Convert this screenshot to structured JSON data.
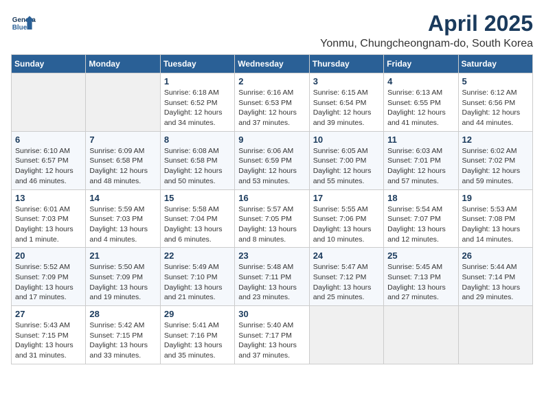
{
  "logo": {
    "line1": "General",
    "line2": "Blue"
  },
  "title": "April 2025",
  "subtitle": "Yonmu, Chungcheongnam-do, South Korea",
  "days_of_week": [
    "Sunday",
    "Monday",
    "Tuesday",
    "Wednesday",
    "Thursday",
    "Friday",
    "Saturday"
  ],
  "weeks": [
    [
      {
        "day": "",
        "info": ""
      },
      {
        "day": "",
        "info": ""
      },
      {
        "day": "1",
        "info": "Sunrise: 6:18 AM\nSunset: 6:52 PM\nDaylight: 12 hours and 34 minutes."
      },
      {
        "day": "2",
        "info": "Sunrise: 6:16 AM\nSunset: 6:53 PM\nDaylight: 12 hours and 37 minutes."
      },
      {
        "day": "3",
        "info": "Sunrise: 6:15 AM\nSunset: 6:54 PM\nDaylight: 12 hours and 39 minutes."
      },
      {
        "day": "4",
        "info": "Sunrise: 6:13 AM\nSunset: 6:55 PM\nDaylight: 12 hours and 41 minutes."
      },
      {
        "day": "5",
        "info": "Sunrise: 6:12 AM\nSunset: 6:56 PM\nDaylight: 12 hours and 44 minutes."
      }
    ],
    [
      {
        "day": "6",
        "info": "Sunrise: 6:10 AM\nSunset: 6:57 PM\nDaylight: 12 hours and 46 minutes."
      },
      {
        "day": "7",
        "info": "Sunrise: 6:09 AM\nSunset: 6:58 PM\nDaylight: 12 hours and 48 minutes."
      },
      {
        "day": "8",
        "info": "Sunrise: 6:08 AM\nSunset: 6:58 PM\nDaylight: 12 hours and 50 minutes."
      },
      {
        "day": "9",
        "info": "Sunrise: 6:06 AM\nSunset: 6:59 PM\nDaylight: 12 hours and 53 minutes."
      },
      {
        "day": "10",
        "info": "Sunrise: 6:05 AM\nSunset: 7:00 PM\nDaylight: 12 hours and 55 minutes."
      },
      {
        "day": "11",
        "info": "Sunrise: 6:03 AM\nSunset: 7:01 PM\nDaylight: 12 hours and 57 minutes."
      },
      {
        "day": "12",
        "info": "Sunrise: 6:02 AM\nSunset: 7:02 PM\nDaylight: 12 hours and 59 minutes."
      }
    ],
    [
      {
        "day": "13",
        "info": "Sunrise: 6:01 AM\nSunset: 7:03 PM\nDaylight: 13 hours and 1 minute."
      },
      {
        "day": "14",
        "info": "Sunrise: 5:59 AM\nSunset: 7:03 PM\nDaylight: 13 hours and 4 minutes."
      },
      {
        "day": "15",
        "info": "Sunrise: 5:58 AM\nSunset: 7:04 PM\nDaylight: 13 hours and 6 minutes."
      },
      {
        "day": "16",
        "info": "Sunrise: 5:57 AM\nSunset: 7:05 PM\nDaylight: 13 hours and 8 minutes."
      },
      {
        "day": "17",
        "info": "Sunrise: 5:55 AM\nSunset: 7:06 PM\nDaylight: 13 hours and 10 minutes."
      },
      {
        "day": "18",
        "info": "Sunrise: 5:54 AM\nSunset: 7:07 PM\nDaylight: 13 hours and 12 minutes."
      },
      {
        "day": "19",
        "info": "Sunrise: 5:53 AM\nSunset: 7:08 PM\nDaylight: 13 hours and 14 minutes."
      }
    ],
    [
      {
        "day": "20",
        "info": "Sunrise: 5:52 AM\nSunset: 7:09 PM\nDaylight: 13 hours and 17 minutes."
      },
      {
        "day": "21",
        "info": "Sunrise: 5:50 AM\nSunset: 7:09 PM\nDaylight: 13 hours and 19 minutes."
      },
      {
        "day": "22",
        "info": "Sunrise: 5:49 AM\nSunset: 7:10 PM\nDaylight: 13 hours and 21 minutes."
      },
      {
        "day": "23",
        "info": "Sunrise: 5:48 AM\nSunset: 7:11 PM\nDaylight: 13 hours and 23 minutes."
      },
      {
        "day": "24",
        "info": "Sunrise: 5:47 AM\nSunset: 7:12 PM\nDaylight: 13 hours and 25 minutes."
      },
      {
        "day": "25",
        "info": "Sunrise: 5:45 AM\nSunset: 7:13 PM\nDaylight: 13 hours and 27 minutes."
      },
      {
        "day": "26",
        "info": "Sunrise: 5:44 AM\nSunset: 7:14 PM\nDaylight: 13 hours and 29 minutes."
      }
    ],
    [
      {
        "day": "27",
        "info": "Sunrise: 5:43 AM\nSunset: 7:15 PM\nDaylight: 13 hours and 31 minutes."
      },
      {
        "day": "28",
        "info": "Sunrise: 5:42 AM\nSunset: 7:15 PM\nDaylight: 13 hours and 33 minutes."
      },
      {
        "day": "29",
        "info": "Sunrise: 5:41 AM\nSunset: 7:16 PM\nDaylight: 13 hours and 35 minutes."
      },
      {
        "day": "30",
        "info": "Sunrise: 5:40 AM\nSunset: 7:17 PM\nDaylight: 13 hours and 37 minutes."
      },
      {
        "day": "",
        "info": ""
      },
      {
        "day": "",
        "info": ""
      },
      {
        "day": "",
        "info": ""
      }
    ]
  ]
}
